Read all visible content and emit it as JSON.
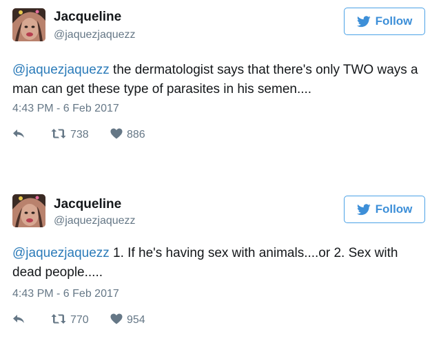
{
  "tweets": [
    {
      "name": "Jacqueline",
      "handle": "@jaquezjaquezz",
      "follow_label": "Follow",
      "mention": "@jaquezjaquezz",
      "body": " the dermatologist says that there's only TWO ways a man can get these type of parasites in his semen....",
      "timestamp": "4:43 PM - 6 Feb 2017",
      "retweets": "738",
      "likes": "886"
    },
    {
      "name": "Jacqueline",
      "handle": "@jaquezjaquezz",
      "follow_label": "Follow",
      "mention": "@jaquezjaquezz",
      "body": " 1. If he's having sex with animals....or 2. Sex with dead people.....",
      "timestamp": "4:43 PM - 6 Feb 2017",
      "retweets": "770",
      "likes": "954"
    }
  ],
  "icons": {
    "follow": "twitter-bird-icon",
    "reply": "reply-arrow-icon",
    "retweet": "retweet-icon",
    "like": "heart-icon"
  },
  "colors": {
    "accent": "#3d8fd8",
    "link": "#2b7bb9",
    "muted": "#657786",
    "text": "#14171a"
  }
}
